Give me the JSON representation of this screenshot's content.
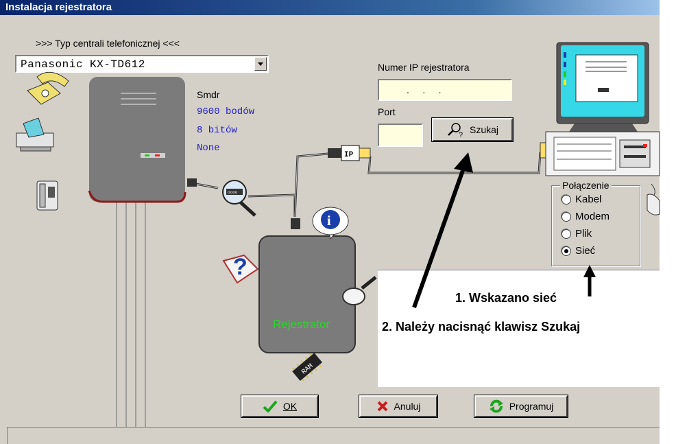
{
  "window": {
    "title": "Instalacja rejestratora"
  },
  "pbx": {
    "caption": ">>> Typ centrali telefonicznej <<<",
    "selected": "Panasonic KX-TD612"
  },
  "smdr": {
    "label": "Smdr",
    "baud": "9600 bodów",
    "bits": "8 bitów",
    "parity": "None"
  },
  "ip": {
    "label": "Numer IP rejestratora",
    "value": ".     .     .",
    "port_label": "Port",
    "port_value": "",
    "search_button": "Szukaj"
  },
  "connection": {
    "legend": "Połączenie",
    "options": [
      "Kabel",
      "Modem",
      "Plik",
      "Sieć"
    ],
    "selected": "Sieć"
  },
  "device": {
    "label": "Rejestrator",
    "chip_label": "RAM",
    "ip_plug_label": "IP"
  },
  "annotation": {
    "line1": "1. Wskazano sieć",
    "line2": "2. Należy nacisnąć klawisz Szukaj"
  },
  "buttons": {
    "ok": "OK",
    "cancel": "Anuluj",
    "program": "Programuj"
  },
  "colors": {
    "title_bar": "#0a246a",
    "smdr_values": "#1c1ccc",
    "device_label": "#2bd62b",
    "field_bg": "#ffffe0",
    "monitor_screen": "#36d8e8"
  },
  "icons": [
    "phone-icon",
    "fax-icon",
    "intercom-icon",
    "pbx-box",
    "magnifier-icon",
    "info-icon",
    "help-book-icon",
    "ram-chip-icon",
    "computer-icon",
    "mouse-icon",
    "check-icon",
    "x-icon",
    "refresh-icon"
  ]
}
